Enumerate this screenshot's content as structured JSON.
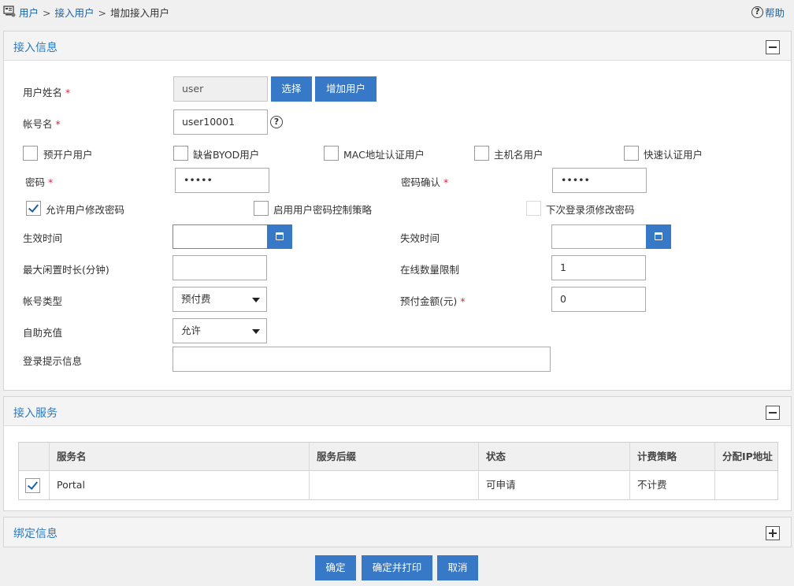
{
  "breadcrumb": {
    "items": [
      "用户",
      "接入用户",
      "增加接入用户"
    ],
    "separator": ">"
  },
  "help_label": "帮助",
  "sections": {
    "access_info": "接入信息",
    "access_service": "接入服务",
    "binding_info": "绑定信息"
  },
  "form": {
    "username": {
      "label": "用户姓名",
      "value": "user",
      "select_button": "选择",
      "add_button": "增加用户"
    },
    "account": {
      "label": "帐号名",
      "value": "user10001"
    },
    "user_types": [
      {
        "label": "预开户用户",
        "checked": false
      },
      {
        "label": "缺省BYOD用户",
        "checked": false
      },
      {
        "label": "MAC地址认证用户",
        "checked": false
      },
      {
        "label": "主机名用户",
        "checked": false
      },
      {
        "label": "快速认证用户",
        "checked": false
      }
    ],
    "password": {
      "label": "密码",
      "value": "•••••"
    },
    "password_confirm": {
      "label": "密码确认",
      "value": "•••••"
    },
    "allow_modify_password": {
      "label": "允许用户修改密码",
      "checked": true
    },
    "enable_password_policy": {
      "label": "启用用户密码控制策略",
      "checked": false
    },
    "change_on_next_login": {
      "label": "下次登录须修改密码",
      "checked": false
    },
    "effective_time": {
      "label": "生效时间",
      "value": ""
    },
    "expire_time": {
      "label": "失效时间",
      "value": ""
    },
    "max_idle": {
      "label": "最大闲置时长(分钟)",
      "value": ""
    },
    "online_limit": {
      "label": "在线数量限制",
      "value": "1"
    },
    "account_type": {
      "label": "帐号类型",
      "value": "预付费"
    },
    "prepaid_amount": {
      "label": "预付金额(元)",
      "value": "0"
    },
    "self_recharge": {
      "label": "自助充值",
      "value": "允许"
    },
    "login_message": {
      "label": "登录提示信息",
      "value": ""
    },
    "required_mark": "*"
  },
  "service_table": {
    "columns": [
      "服务名",
      "服务后缀",
      "状态",
      "计费策略",
      "分配IP地址"
    ],
    "rows": [
      {
        "checked": true,
        "cells": [
          "Portal",
          "",
          "可申请",
          "不计费",
          ""
        ]
      }
    ]
  },
  "footer": {
    "ok": "确定",
    "ok_print": "确定并打印",
    "cancel": "取消"
  },
  "colors": {
    "accent": "#3778c7",
    "link": "#1b62a8",
    "section_title": "#2b7ac4",
    "required": "#d9263c"
  }
}
